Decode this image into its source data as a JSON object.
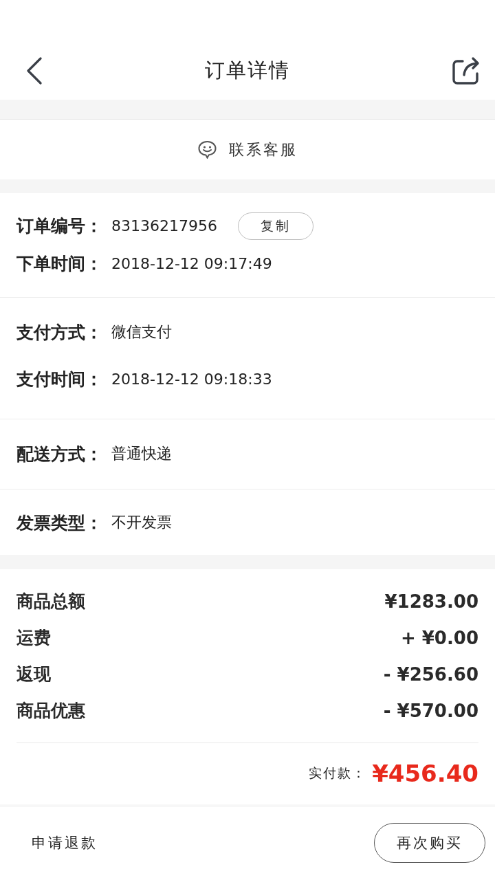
{
  "header": {
    "title": "订单详情"
  },
  "contact": {
    "label": "联系客服"
  },
  "sections": [
    {
      "rows": [
        {
          "label": "订单编号：",
          "value": "83136217956",
          "action": "复制"
        },
        {
          "label": "下单时间：",
          "value": "2018-12-12 09:17:49"
        }
      ]
    },
    {
      "rows": [
        {
          "label": "支付方式：",
          "value": "微信支付"
        },
        {
          "label": "支付时间：",
          "value": "2018-12-12 09:18:33"
        }
      ]
    },
    {
      "rows": [
        {
          "label": "配送方式：",
          "value": "普通快递"
        }
      ]
    },
    {
      "rows": [
        {
          "label": "发票类型：",
          "value": "不开发票"
        }
      ]
    }
  ],
  "amounts": [
    {
      "label": "商品总额",
      "value": "¥1283.00"
    },
    {
      "label": "运费",
      "value": "+ ¥0.00"
    },
    {
      "label": "返现",
      "value": "- ¥256.60"
    },
    {
      "label": "商品优惠",
      "value": "- ¥570.00"
    }
  ],
  "total": {
    "label": "实付款：",
    "value": "¥456.40"
  },
  "footer": {
    "link": "申请退款",
    "button": "再次购买"
  }
}
